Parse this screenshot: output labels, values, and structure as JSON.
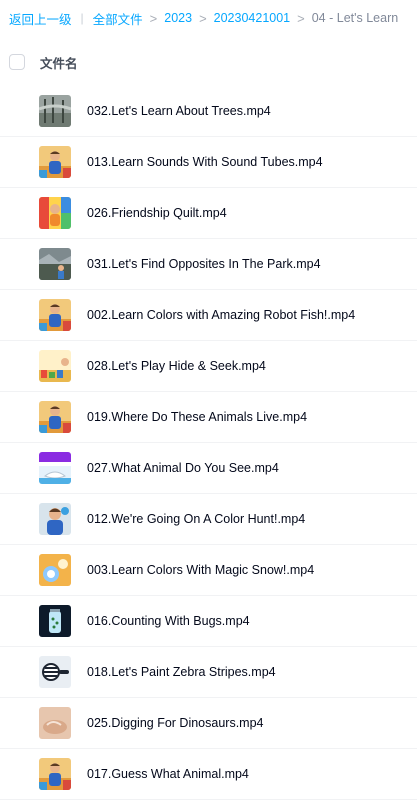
{
  "breadcrumb": {
    "back_label": "返回上一级",
    "divider": "|",
    "separator": ">",
    "items": [
      "全部文件",
      "2023",
      "20230421001"
    ],
    "current": "04 - Let's Learn"
  },
  "header": {
    "name_column": "文件名"
  },
  "files": [
    {
      "name": "032.Let's Learn About Trees.mp4",
      "thumb": "trees"
    },
    {
      "name": "013.Learn Sounds With Sound Tubes.mp4",
      "thumb": "person"
    },
    {
      "name": "026.Friendship Quilt.mp4",
      "thumb": "quilt"
    },
    {
      "name": "031.Let's Find Opposites In The Park.mp4",
      "thumb": "park"
    },
    {
      "name": "002.Learn Colors with Amazing Robot Fish!.mp4",
      "thumb": "person"
    },
    {
      "name": "028.Let's Play Hide & Seek.mp4",
      "thumb": "hideseek"
    },
    {
      "name": "019.Where Do These Animals Live.mp4",
      "thumb": "person"
    },
    {
      "name": "027.What Animal Do You See.mp4",
      "thumb": "animal"
    },
    {
      "name": "012.We're Going On A Color Hunt!.mp4",
      "thumb": "colorhunt"
    },
    {
      "name": "003.Learn Colors With Magic Snow!.mp4",
      "thumb": "snow"
    },
    {
      "name": "016.Counting With Bugs.mp4",
      "thumb": "bugs"
    },
    {
      "name": "018.Let's Paint Zebra Stripes.mp4",
      "thumb": "zebra"
    },
    {
      "name": "025.Digging For Dinosaurs.mp4",
      "thumb": "dino"
    },
    {
      "name": "017.Guess What Animal.mp4",
      "thumb": "person"
    }
  ]
}
